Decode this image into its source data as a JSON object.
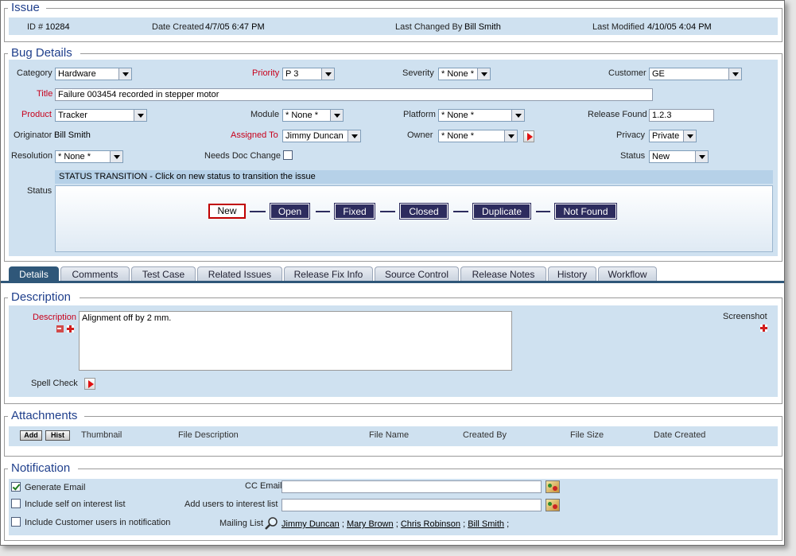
{
  "issue": {
    "legend": "Issue",
    "id_label": "ID #",
    "id_value": "10284",
    "date_created_label": "Date Created",
    "date_created": "4/7/05 6:47 PM",
    "last_changed_by_label": "Last Changed By",
    "last_changed_by": "Bill Smith",
    "last_modified_label": "Last Modified",
    "last_modified": "4/10/05 4:04 PM"
  },
  "bug": {
    "legend": "Bug Details",
    "category_label": "Category",
    "category": "Hardware",
    "priority_label": "Priority",
    "priority": "P 3",
    "severity_label": "Severity",
    "severity": "* None *",
    "customer_label": "Customer",
    "customer": "GE",
    "title_label": "Title",
    "title": "Failure 003454 recorded in stepper motor",
    "product_label": "Product",
    "product": "Tracker",
    "module_label": "Module",
    "module": "* None *",
    "platform_label": "Platform",
    "platform": "* None *",
    "release_found_label": "Release Found",
    "release_found": "1.2.3",
    "originator_label": "Originator",
    "originator": "Bill Smith",
    "assigned_to_label": "Assigned To",
    "assigned_to": "Jimmy Duncan",
    "owner_label": "Owner",
    "owner": "* None *",
    "privacy_label": "Privacy",
    "privacy": "Private",
    "resolution_label": "Resolution",
    "resolution": "* None *",
    "needs_doc_label": "Needs Doc Change",
    "status_label": "Status",
    "status": "New",
    "transition_header": "STATUS TRANSITION - Click on new status to transition the issue",
    "transition_label": "Status",
    "states": [
      "New",
      "Open",
      "Fixed",
      "Closed",
      "Duplicate",
      "Not Found"
    ]
  },
  "tabs": [
    "Details",
    "Comments",
    "Test Case",
    "Related Issues",
    "Release Fix Info",
    "Source Control",
    "Release Notes",
    "History",
    "Workflow"
  ],
  "description": {
    "legend": "Description",
    "label": "Description",
    "text": "Alignment off by 2 mm.",
    "screenshot_label": "Screenshot",
    "spell_check_label": "Spell Check"
  },
  "attachments": {
    "legend": "Attachments",
    "add_label": "Add",
    "hist_label": "Hist",
    "columns": [
      "Thumbnail",
      "File Description",
      "File Name",
      "Created By",
      "File Size",
      "Date Created"
    ]
  },
  "notification": {
    "legend": "Notification",
    "generate_email_label": "Generate Email",
    "include_self_label": "Include self on interest list",
    "include_customer_label": "Include Customer users in notification",
    "cc_email_label": "CC Email",
    "add_users_label": "Add users to interest list",
    "mailing_list_label": "Mailing List",
    "mailing_list": [
      "Jimmy Duncan",
      "Mary Brown",
      "Chris Robinson",
      "Bill Smith"
    ],
    "separator": ";"
  },
  "colors": {
    "band": "#cfe1f0",
    "legend": "#1f3f8c",
    "required": "#c8001b",
    "state": "#2d2c5e",
    "active_tab": "#2f5779"
  }
}
